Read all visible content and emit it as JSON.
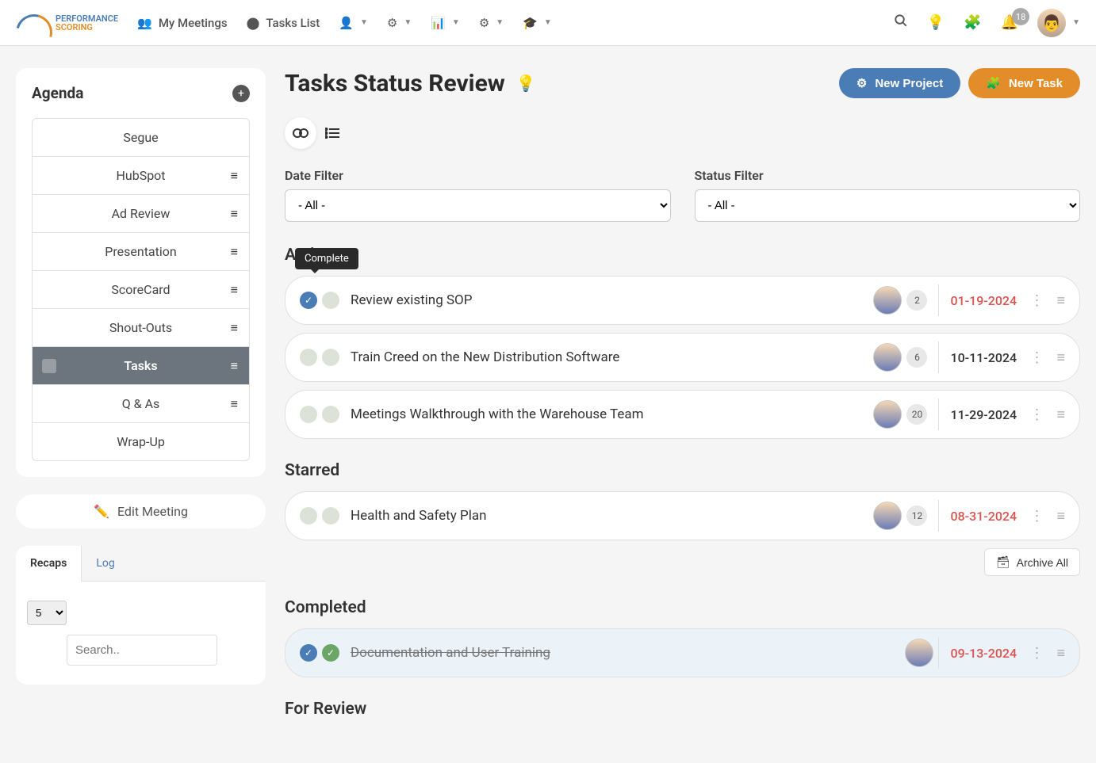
{
  "navbar": {
    "my_meetings": "My Meetings",
    "tasks_list": "Tasks List",
    "notification_count": "18"
  },
  "sidebar": {
    "agenda_title": "Agenda",
    "items": [
      {
        "label": "Segue",
        "drag": false
      },
      {
        "label": "HubSpot",
        "drag": true
      },
      {
        "label": "Ad Review",
        "drag": true
      },
      {
        "label": "Presentation",
        "drag": true
      },
      {
        "label": "ScoreCard",
        "drag": true
      },
      {
        "label": "Shout-Outs",
        "drag": true
      },
      {
        "label": "Tasks",
        "drag": true,
        "active": true
      },
      {
        "label": "Q & As",
        "drag": true
      },
      {
        "label": "Wrap-Up",
        "drag": false
      }
    ],
    "edit_meeting": "Edit Meeting",
    "tabs": {
      "recaps": "Recaps",
      "log": "Log"
    },
    "page_size": "5",
    "search_placeholder": "Search.."
  },
  "content": {
    "title": "Tasks Status Review",
    "new_project_btn": "New Project",
    "new_task_btn": "New Task",
    "date_filter_label": "Date Filter",
    "date_filter_value": "- All -",
    "status_filter_label": "Status Filter",
    "status_filter_value": "- All -",
    "tooltip": "Complete",
    "archive_all": "Archive All",
    "sections": {
      "active": {
        "title": "Active",
        "tasks": [
          {
            "title": "Review existing SOP",
            "count": "2",
            "date": "01-19-2024",
            "overdue": true,
            "checked": true
          },
          {
            "title": "Train Creed on the New Distribution Software",
            "count": "6",
            "date": "10-11-2024",
            "overdue": false,
            "checked": false
          },
          {
            "title": "Meetings Walkthrough with the Warehouse Team",
            "count": "20",
            "date": "11-29-2024",
            "overdue": false,
            "checked": false
          }
        ]
      },
      "starred": {
        "title": "Starred",
        "tasks": [
          {
            "title": "Health and Safety Plan",
            "count": "12",
            "date": "08-31-2024",
            "overdue": true,
            "checked": false
          }
        ]
      },
      "completed": {
        "title": "Completed",
        "tasks": [
          {
            "title": "Documentation and User Training",
            "date": "09-13-2024",
            "overdue": true,
            "checked": true
          }
        ]
      },
      "for_review": {
        "title": "For Review"
      }
    }
  }
}
